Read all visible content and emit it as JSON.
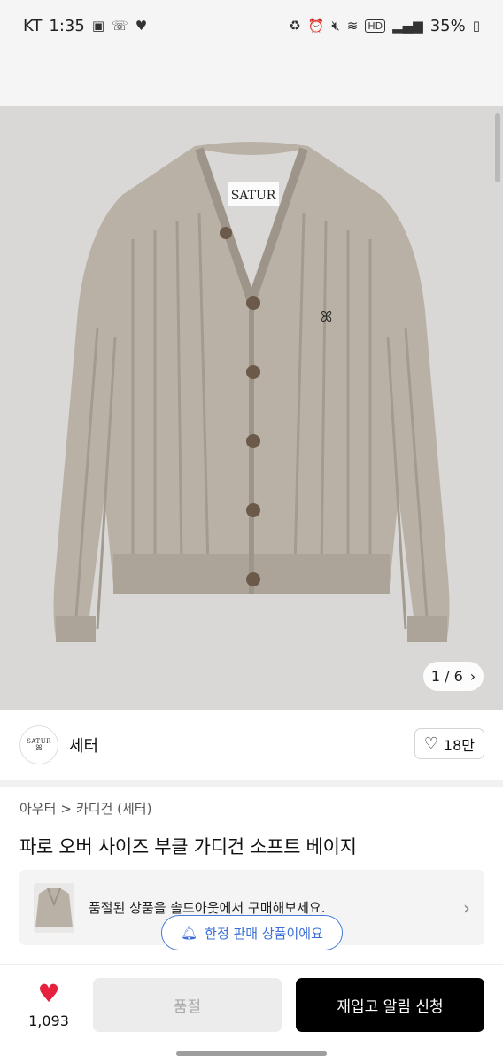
{
  "status_bar": {
    "carrier": "KT",
    "time": "1:35",
    "hd_label": "HD",
    "battery": "35%"
  },
  "gallery": {
    "garment_label": "SATUR",
    "indicator": "1 / 6"
  },
  "brand": {
    "logo_text": "SATUR",
    "name": "세터",
    "likes": "18만"
  },
  "breadcrumb": {
    "level1": "아우터",
    "separator": ">",
    "level2": "카디건 (세터)"
  },
  "product": {
    "title": "파로 오버 사이즈 부클 가디건 소프트 베이지"
  },
  "soldout_banner": {
    "text": "품절된 상품을 솔드아웃에서 구매해보세요."
  },
  "limited_pill": {
    "text": "한정 판매 상품이에요"
  },
  "bottom_bar": {
    "wish_count": "1,093",
    "soldout_label": "품절",
    "restock_label": "재입고 알림 신청"
  },
  "colors": {
    "accent_blue": "#3b6fd6",
    "heart_red": "#e5213d",
    "garment": "#b9b1a6"
  }
}
